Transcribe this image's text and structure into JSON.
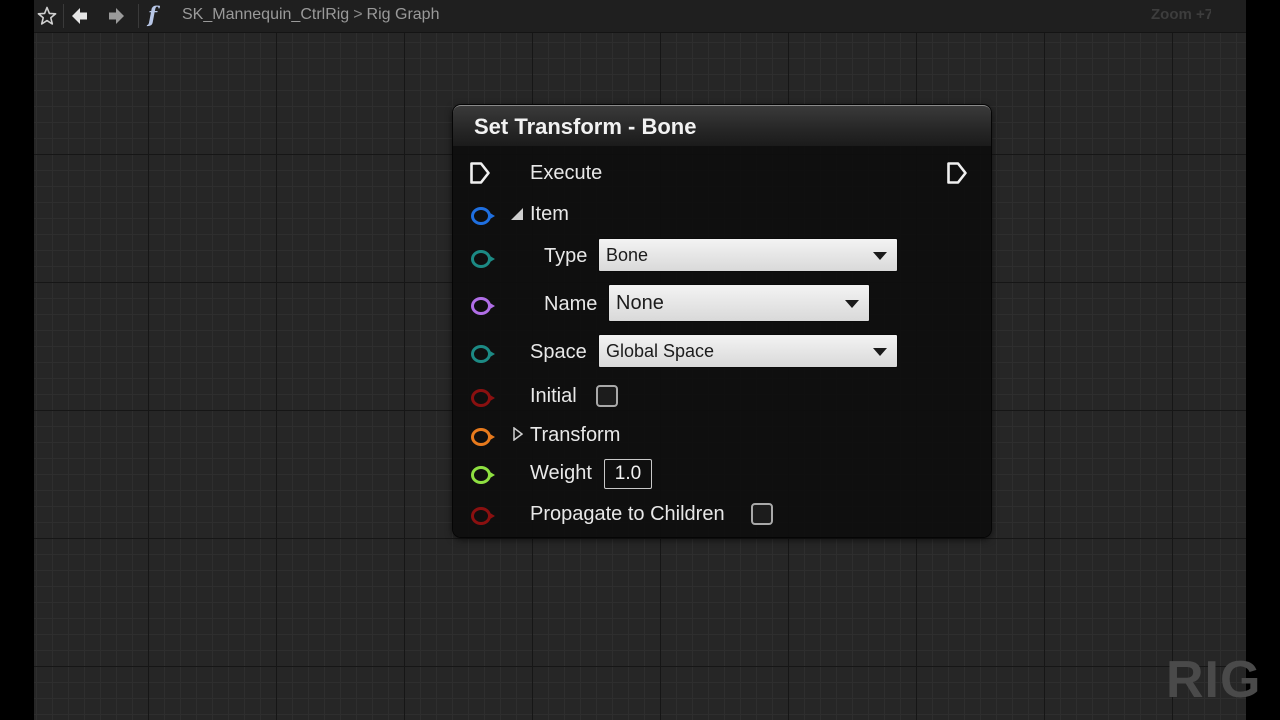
{
  "breadcrumb": {
    "asset": "SK_Mannequin_CtrlRig",
    "separator": ">",
    "graph": "Rig Graph"
  },
  "toolbar": {
    "icons": [
      "star-icon",
      "back-arrow-icon",
      "forward-arrow-icon",
      "function-icon"
    ],
    "function_glyph": "f"
  },
  "zoom_label": "Zoom +7",
  "watermark": "RIG",
  "node": {
    "title": "Set Transform - Bone",
    "execute_label": "Execute",
    "item_label": "Item",
    "type_label": "Type",
    "type_value": "Bone",
    "name_label": "Name",
    "name_value": "None",
    "space_label": "Space",
    "space_value": "Global Space",
    "initial_label": "Initial",
    "initial_checked": false,
    "transform_label": "Transform",
    "weight_label": "Weight",
    "weight_value": "1.0",
    "propagate_label": "Propagate to Children",
    "propagate_checked": false
  },
  "pin_colors": {
    "exec": "#ffffff",
    "item": "#1f6fe0",
    "type": "#1c8a84",
    "name": "#b06ee6",
    "space": "#1c8a84",
    "initial": "#8a1010",
    "transform": "#e77a1d",
    "weight": "#8ee041",
    "propagate": "#8a1010"
  }
}
